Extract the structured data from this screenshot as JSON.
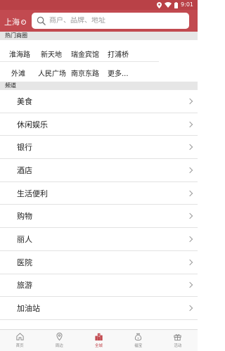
{
  "status_bar": {
    "time": "9:01"
  },
  "header": {
    "city": "上海",
    "search_placeholder": "商户、品牌、地址"
  },
  "hot_areas": {
    "label": "热门商圈",
    "row1": [
      "淮海路",
      "新天地",
      "瑞金宾馆",
      "打浦桥"
    ],
    "row2": [
      "外滩",
      "人民广场",
      "南京东路",
      "更多..."
    ]
  },
  "channels": {
    "label": "频道",
    "items": [
      "美食",
      "休闲娱乐",
      "银行",
      "酒店",
      "生活便利",
      "购物",
      "丽人",
      "医院",
      "旅游",
      "加油站"
    ]
  },
  "tab_bar": {
    "tabs": [
      {
        "label": "首页",
        "icon": "home-icon"
      },
      {
        "label": "周边",
        "icon": "location-pin-icon"
      },
      {
        "label": "全城",
        "icon": "city-buildings-icon",
        "active": true
      },
      {
        "label": "福宝",
        "icon": "money-bag-icon"
      },
      {
        "label": "活动",
        "icon": "gift-icon"
      }
    ],
    "active_color": "#c24a50"
  },
  "colors": {
    "header": "#c24a50",
    "status_bar": "#b94147",
    "section_bg": "#e6e6e6"
  }
}
